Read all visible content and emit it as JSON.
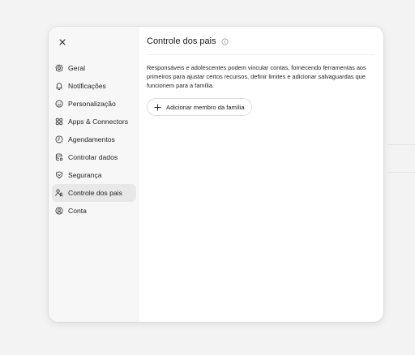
{
  "settings": {
    "close_label": "×",
    "nav": [
      {
        "label": "Geral",
        "icon": "gear-icon"
      },
      {
        "label": "Notificações",
        "icon": "bell-icon"
      },
      {
        "label": "Personalização",
        "icon": "personalization-icon"
      },
      {
        "label": "Apps & Connectors",
        "icon": "apps-icon"
      },
      {
        "label": "Agendamentos",
        "icon": "clock-icon"
      },
      {
        "label": "Controlar dados",
        "icon": "database-icon"
      },
      {
        "label": "Segurança",
        "icon": "shield-icon"
      },
      {
        "label": "Controle dos pais",
        "icon": "parental-icon",
        "active": true
      },
      {
        "label": "Conta",
        "icon": "account-icon"
      }
    ]
  },
  "panel": {
    "title": "Controle dos pais",
    "description": "Responsáveis e adolescentes podem vincular contas, fornecendo ferramentas aos primeiros para ajustar certos recursos, definir limites e adicionar salvaguardas que funcionem para a família.",
    "add_button_label": "Adicionar membro da família"
  },
  "colors": {
    "background": "#f3f3f3",
    "sidebar": "#f7f7f7",
    "active_item": "#e8e8e8",
    "text": "#1f1f1f"
  }
}
